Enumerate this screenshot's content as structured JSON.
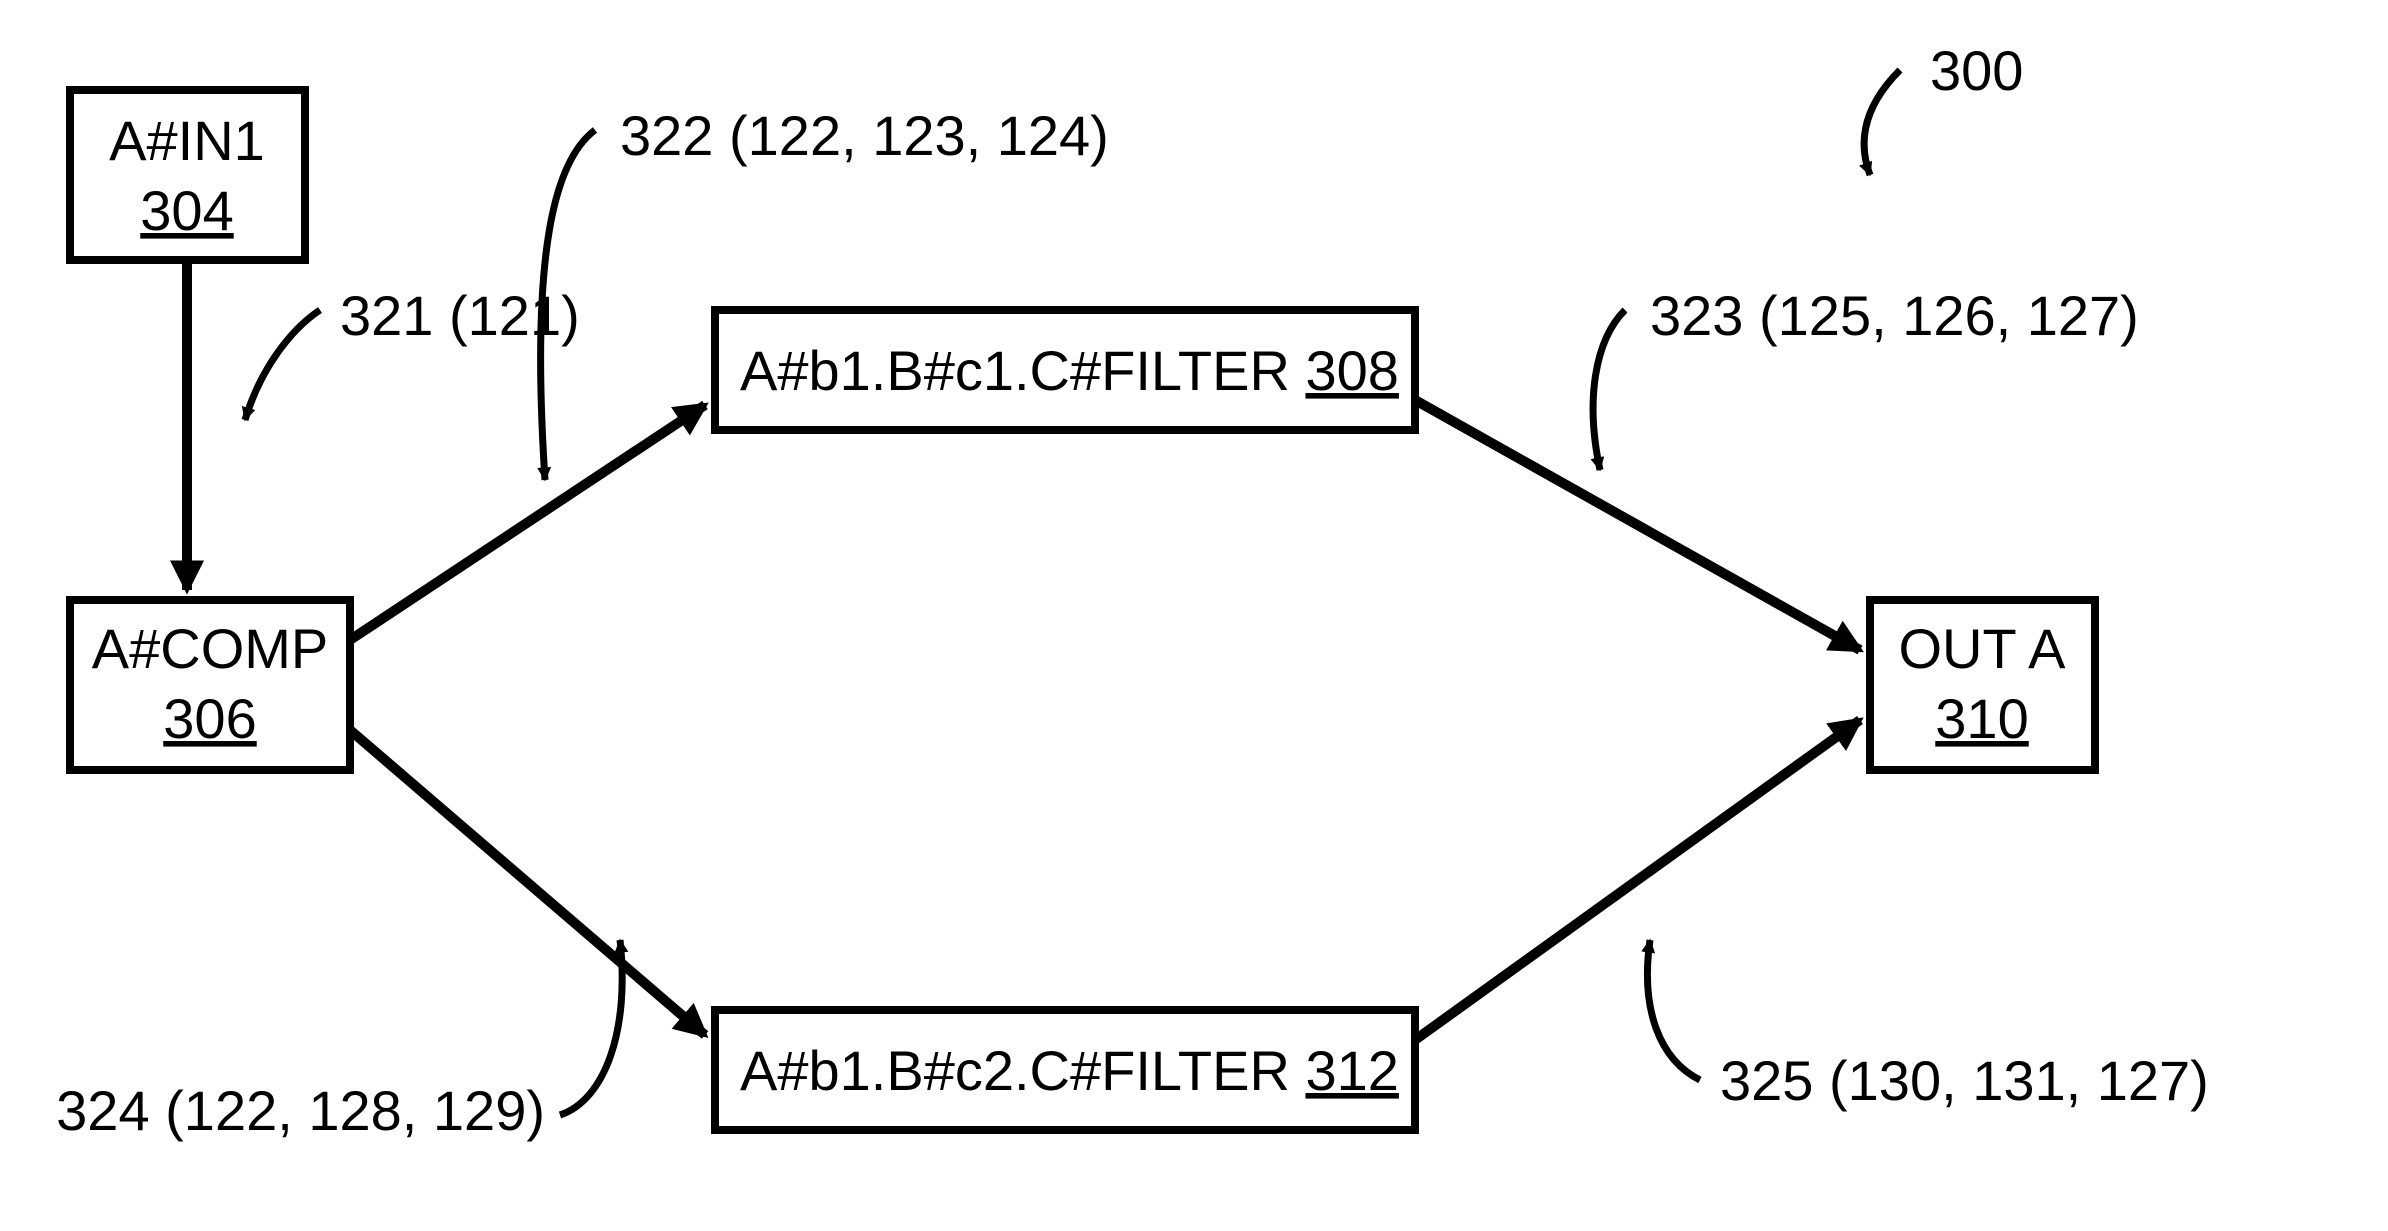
{
  "figureRef": "300",
  "nodes": {
    "in1": {
      "title": "A#IN1",
      "ref": "304"
    },
    "comp": {
      "title": "A#COMP",
      "ref": "306"
    },
    "filter1": {
      "title": "A#b1.B#c1.C#FILTER",
      "ref": "308"
    },
    "filter2": {
      "title": "A#b1.B#c2.C#FILTER",
      "ref": "312"
    },
    "out": {
      "title": "OUT A",
      "ref": "310"
    }
  },
  "edges": {
    "e321": {
      "num": "321",
      "parens": "(121)"
    },
    "e322": {
      "num": "322",
      "parens": "(122, 123, 124)"
    },
    "e323": {
      "num": "323",
      "parens": "(125, 126, 127)"
    },
    "e324": {
      "num": "324",
      "parens": "(122, 128, 129)"
    },
    "e325": {
      "num": "325",
      "parens": "(130, 131, 127)"
    }
  }
}
